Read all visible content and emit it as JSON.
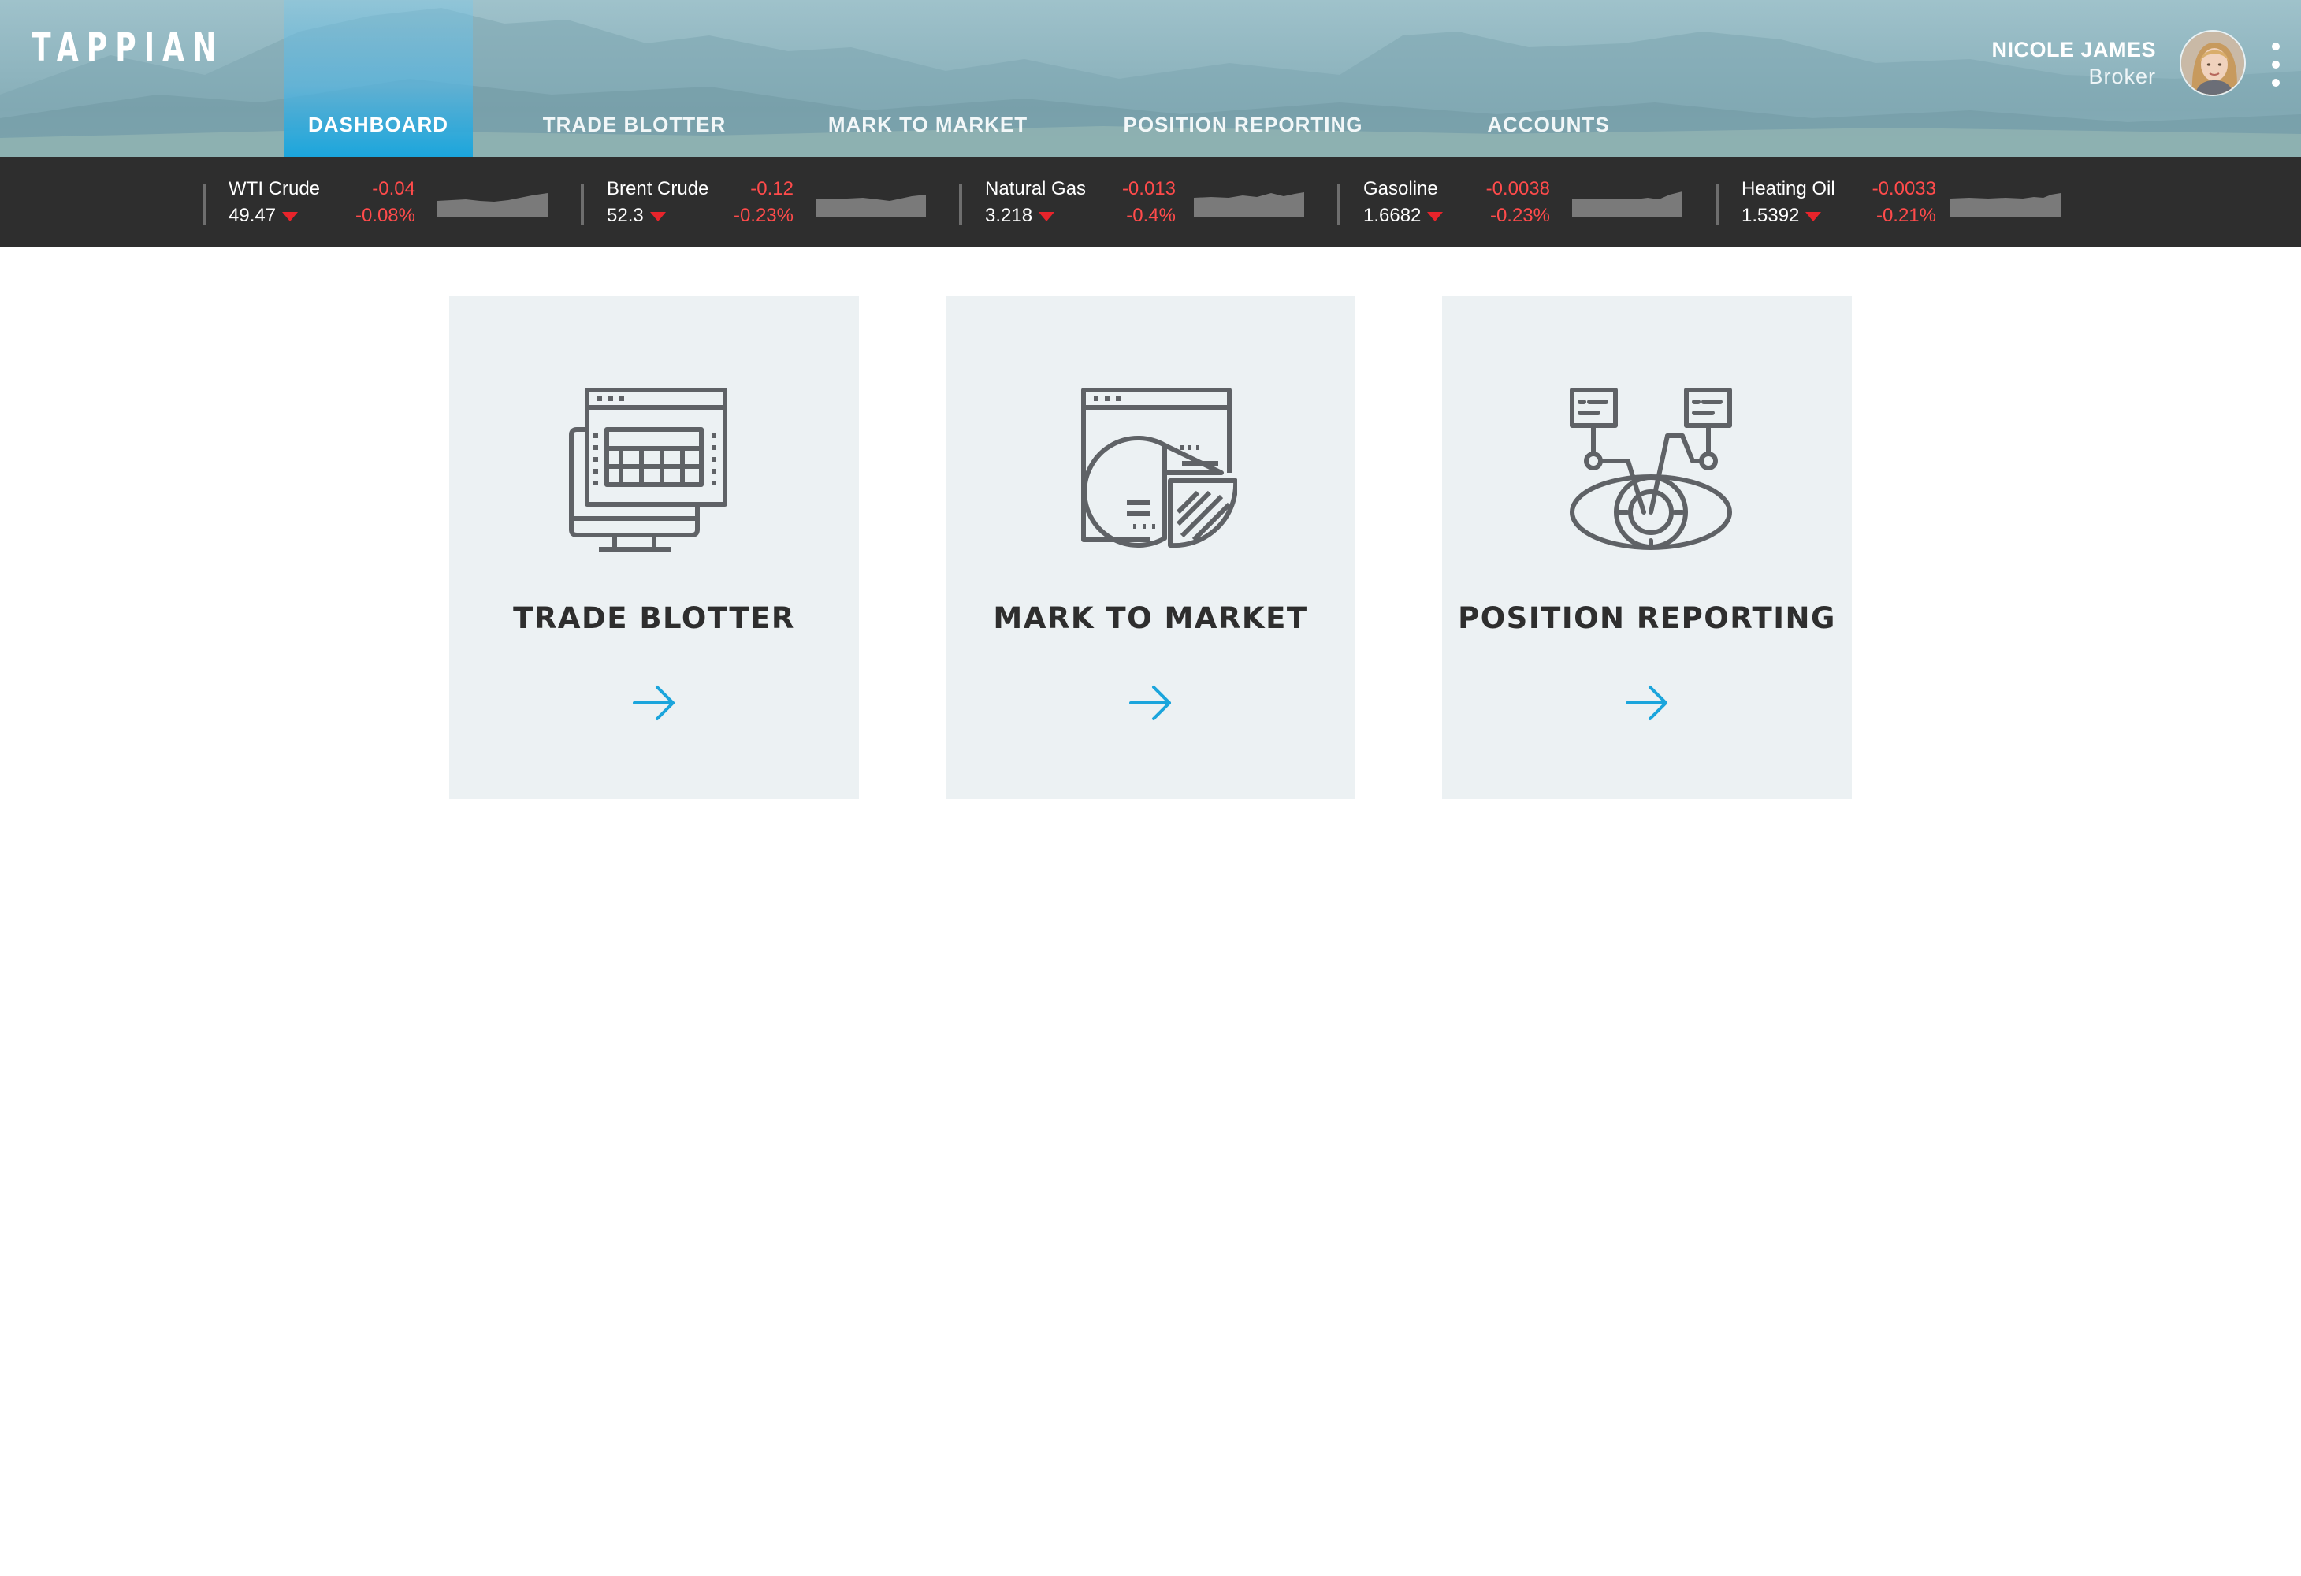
{
  "app": {
    "logo": "TAPPIAN"
  },
  "nav": {
    "items": [
      {
        "label": "DASHBOARD",
        "active": true
      },
      {
        "label": "TRADE BLOTTER",
        "active": false
      },
      {
        "label": "MARK TO MARKET",
        "active": false
      },
      {
        "label": "POSITION REPORTING",
        "active": false
      },
      {
        "label": "ACCOUNTS",
        "active": false
      }
    ]
  },
  "user": {
    "name": "NICOLE JAMES",
    "role": "Broker",
    "menu_icon": "kebab-menu-icon"
  },
  "ticker": [
    {
      "name": "WTI Crude",
      "price": "49.47",
      "change": "-0.04",
      "percent": "-0.08%",
      "direction": "down"
    },
    {
      "name": "Brent Crude",
      "price": "52.3",
      "change": "-0.12",
      "percent": "-0.23%",
      "direction": "down"
    },
    {
      "name": "Natural Gas",
      "price": "3.218",
      "change": "-0.013",
      "percent": "-0.4%",
      "direction": "down"
    },
    {
      "name": "Gasoline",
      "price": "1.6682",
      "change": "-0.0038",
      "percent": "-0.23%",
      "direction": "down"
    },
    {
      "name": "Heating Oil",
      "price": "1.5392",
      "change": "-0.0033",
      "percent": "-0.21%",
      "direction": "down"
    }
  ],
  "cards": [
    {
      "title": "TRADE BLOTTER",
      "icon": "monitor-spreadsheet-icon"
    },
    {
      "title": "MARK TO MARKET",
      "icon": "pie-chart-report-icon"
    },
    {
      "title": "POSITION REPORTING",
      "icon": "eye-analytics-icon"
    }
  ],
  "colors": {
    "accent": "#1ba5dc",
    "negative": "#ff4b4b",
    "down_arrow": "#e8242b",
    "ticker_bg": "#2e2e2e",
    "card_bg": "#ecf1f3",
    "icon": "#5f6266"
  }
}
